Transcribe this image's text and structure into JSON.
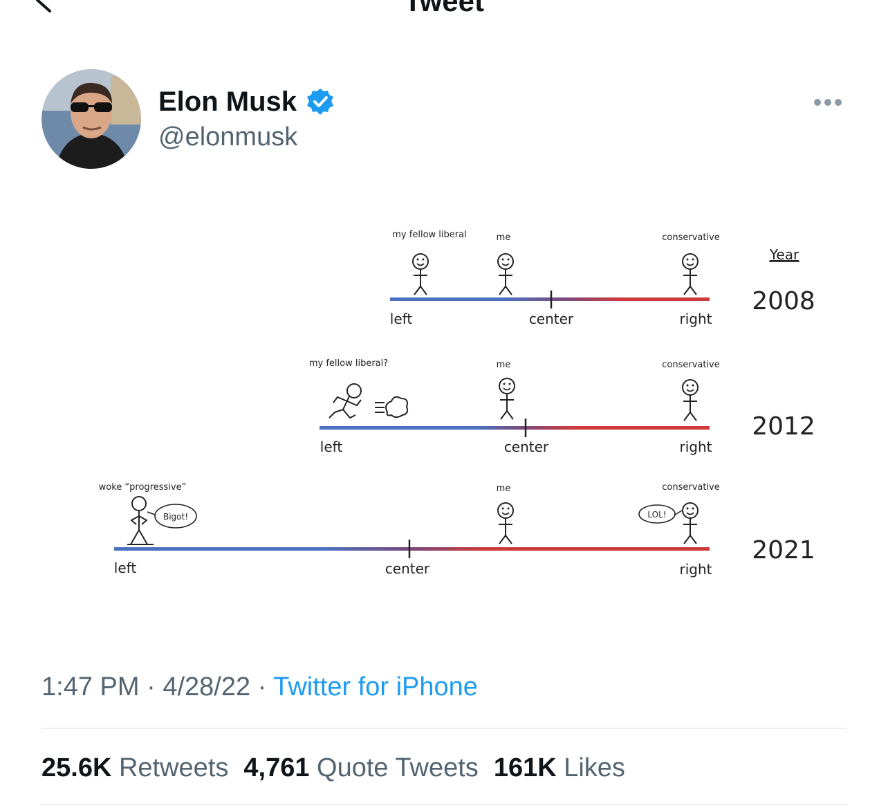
{
  "header": {
    "title": "Tweet"
  },
  "author": {
    "display_name": "Elon Musk",
    "handle": "@elonmusk",
    "verified": true
  },
  "media": {
    "legend_title": "Year",
    "rows": [
      {
        "year": "2008",
        "axis_labels": {
          "left": "left",
          "center": "center",
          "right": "right"
        },
        "figures": [
          "my fellow liberal",
          "me",
          "conservative"
        ]
      },
      {
        "year": "2012",
        "axis_labels": {
          "left": "left",
          "center": "center",
          "right": "right"
        },
        "figures": [
          "my fellow liberal?",
          "me",
          "conservative"
        ]
      },
      {
        "year": "2021",
        "axis_labels": {
          "left": "left",
          "center": "center",
          "right": "right"
        },
        "figures": [
          "woke “progressive”",
          "me",
          "conservative"
        ],
        "speech": {
          "left": "Bigot!",
          "right": "LOL!"
        }
      }
    ]
  },
  "meta": {
    "time": "1:47 PM",
    "sep1": " · ",
    "date": "4/28/22",
    "sep2": " · ",
    "source": "Twitter for iPhone"
  },
  "stats": {
    "retweets": {
      "count": "25.6K",
      "label": "Retweets"
    },
    "quotes": {
      "count": "4,761",
      "label": "Quote Tweets"
    },
    "likes": {
      "count": "161K",
      "label": "Likes"
    }
  },
  "colors": {
    "accent": "#1d9bf0",
    "secondary_text": "#536471",
    "divider": "#cfd9de",
    "left_line": "#4a72c0",
    "right_line": "#cc3b3b"
  }
}
